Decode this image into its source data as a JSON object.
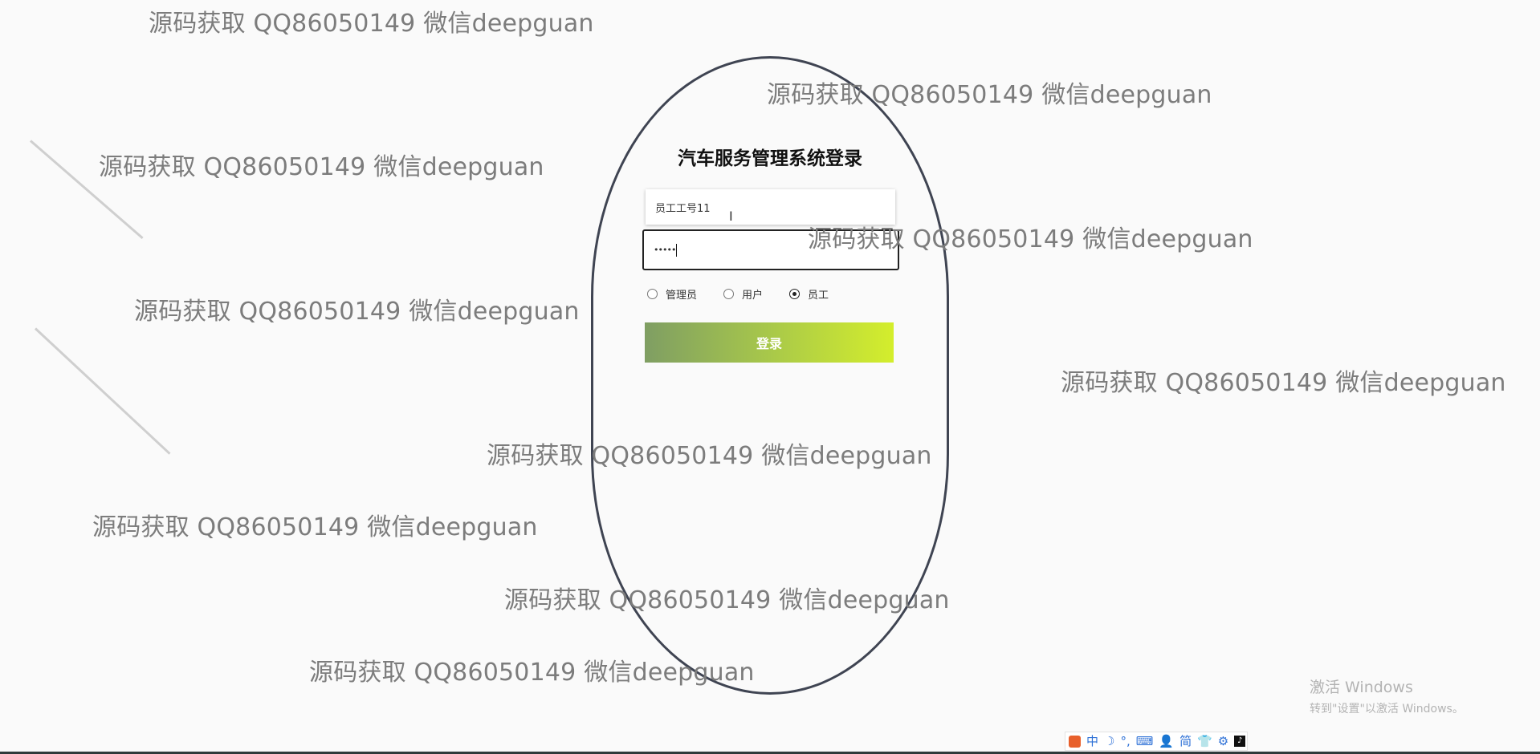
{
  "watermark": {
    "text": "源码获取 QQ86050149 微信deepguan"
  },
  "login": {
    "title": "汽车服务管理系统登录",
    "username_value": "员工工号11",
    "password_mask": "•••••",
    "roles": [
      {
        "label": "管理员",
        "checked": false
      },
      {
        "label": "用户",
        "checked": false
      },
      {
        "label": "员工",
        "checked": true
      }
    ],
    "submit_label": "登录"
  },
  "windows_activation": {
    "title": "激活 Windows",
    "subtitle": "转到\"设置\"以激活 Windows。"
  },
  "tray": {
    "ime_label": "中",
    "simplified_label": "简"
  },
  "colors": {
    "button_gradient_start": "#7f9e63",
    "button_gradient_end": "#d4ee2c",
    "capsule_border": "#3f4452"
  }
}
